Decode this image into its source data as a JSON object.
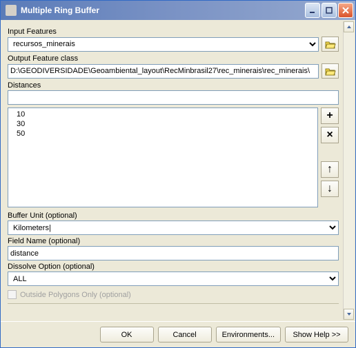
{
  "title": "Multiple Ring Buffer",
  "inputFeatures": {
    "label": "Input Features",
    "value": "recursos_minerais"
  },
  "outputFeatureClass": {
    "label": "Output Feature class",
    "value": "D:\\GEODIVERSIDADE\\Geoambiental_layout\\RecMinbrasil27\\rec_minerais\\rec_minerais\\"
  },
  "distances": {
    "label": "Distances",
    "input": "",
    "items": [
      "10",
      "30",
      "50"
    ]
  },
  "bufferUnit": {
    "label": "Buffer Unit (optional)",
    "value": "Kilometers|"
  },
  "fieldName": {
    "label": "Field Name (optional)",
    "value": "distance"
  },
  "dissolve": {
    "label": "Dissolve Option (optional)",
    "value": "ALL"
  },
  "outsidePolygons": {
    "label": "Outside Polygons Only (optional)"
  },
  "buttons": {
    "ok": "OK",
    "cancel": "Cancel",
    "env": "Environments...",
    "help": "Show Help >>"
  }
}
